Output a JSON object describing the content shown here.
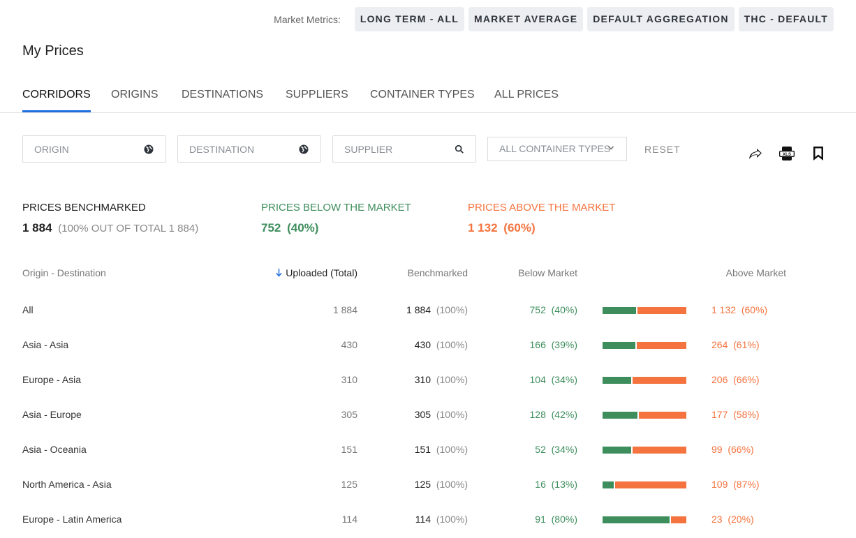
{
  "market_metrics": {
    "label": "Market Metrics:",
    "chips": [
      "LONG TERM - ALL",
      "MARKET AVERAGE",
      "DEFAULT AGGREGATION",
      "THC - DEFAULT"
    ]
  },
  "page_title": "My Prices",
  "tabs": [
    {
      "label": "CORRIDORS",
      "active": true
    },
    {
      "label": "ORIGINS",
      "active": false
    },
    {
      "label": "DESTINATIONS",
      "active": false
    },
    {
      "label": "SUPPLIERS",
      "active": false
    },
    {
      "label": "CONTAINER TYPES",
      "active": false
    },
    {
      "label": "ALL PRICES",
      "active": false
    }
  ],
  "filters": {
    "origin_placeholder": "ORIGIN",
    "destination_placeholder": "DESTINATION",
    "supplier_placeholder": "SUPPLIER",
    "container_select": "ALL CONTAINER TYPES",
    "reset_label": "RESET"
  },
  "toolbar_icons": [
    "share-icon",
    "xls-export-icon",
    "bookmark-icon"
  ],
  "summary": {
    "benchmarked": {
      "label": "PRICES BENCHMARKED",
      "value": "1 884",
      "sub": "(100%  OUT OF TOTAL 1 884)"
    },
    "below": {
      "label": "PRICES BELOW THE MARKET",
      "value": "752",
      "pct": "(40%)"
    },
    "above": {
      "label": "PRICES ABOVE THE MARKET",
      "value": "1 132",
      "pct": "(60%)"
    }
  },
  "colors": {
    "below": "#3e8e5d",
    "above": "#f4733e",
    "accent": "#1f6fe0"
  },
  "table": {
    "headers": {
      "origin_destination": "Origin - Destination",
      "uploaded": "Uploaded (Total)",
      "benchmarked": "Benchmarked",
      "below": "Below Market",
      "above": "Above Market"
    },
    "sort_icon": "arrow-down-icon",
    "rows": [
      {
        "name": "All",
        "uploaded": "1 884",
        "bench": "1 884",
        "bench_pct": "(100%)",
        "below": "752",
        "below_pct": "(40%)",
        "above": "1 132",
        "above_pct": "(60%)",
        "below_fraction": 0.4
      },
      {
        "name": "Asia - Asia",
        "uploaded": "430",
        "bench": "430",
        "bench_pct": "(100%)",
        "below": "166",
        "below_pct": "(39%)",
        "above": "264",
        "above_pct": "(61%)",
        "below_fraction": 0.39
      },
      {
        "name": "Europe - Asia",
        "uploaded": "310",
        "bench": "310",
        "bench_pct": "(100%)",
        "below": "104",
        "below_pct": "(34%)",
        "above": "206",
        "above_pct": "(66%)",
        "below_fraction": 0.34
      },
      {
        "name": "Asia - Europe",
        "uploaded": "305",
        "bench": "305",
        "bench_pct": "(100%)",
        "below": "128",
        "below_pct": "(42%)",
        "above": "177",
        "above_pct": "(58%)",
        "below_fraction": 0.42
      },
      {
        "name": "Asia - Oceania",
        "uploaded": "151",
        "bench": "151",
        "bench_pct": "(100%)",
        "below": "52",
        "below_pct": "(34%)",
        "above": "99",
        "above_pct": "(66%)",
        "below_fraction": 0.34
      },
      {
        "name": "North America - Asia",
        "uploaded": "125",
        "bench": "125",
        "bench_pct": "(100%)",
        "below": "16",
        "below_pct": "(13%)",
        "above": "109",
        "above_pct": "(87%)",
        "below_fraction": 0.13
      },
      {
        "name": "Europe - Latin America",
        "uploaded": "114",
        "bench": "114",
        "bench_pct": "(100%)",
        "below": "91",
        "below_pct": "(80%)",
        "above": "23",
        "above_pct": "(20%)",
        "below_fraction": 0.8
      }
    ]
  }
}
